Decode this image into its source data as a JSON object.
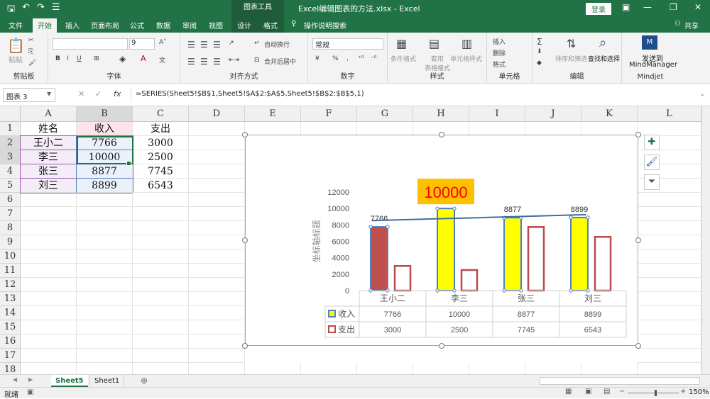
{
  "titlebar": {
    "chart_tools": "图表工具",
    "title": "Excel编辑图表的方法.xlsx  -  Excel",
    "login": "登录"
  },
  "tabs": [
    "文件",
    "开始",
    "插入",
    "页面布局",
    "公式",
    "数据",
    "审阅",
    "视图",
    "设计",
    "格式",
    "操作说明搜索"
  ],
  "share": "共享",
  "ribbon": {
    "paste": "粘贴",
    "clipboard": "剪贴板",
    "font_size": "9",
    "font_group": "字体",
    "wrap": "自动换行",
    "merge": "合并后居中",
    "align_group": "对齐方式",
    "number_format": "常规",
    "number_group": "数字",
    "cond_format": "条件格式",
    "table_format": "套用\n表格格式",
    "cell_style": "单元格样式",
    "style_group": "样式",
    "insert": "插入",
    "delete": "删除",
    "format": "格式",
    "cells_group": "单元格",
    "sort_filter": "排序和筛选",
    "find_select": "查找和选择",
    "edit_group": "编辑",
    "send_to": "发送到",
    "mindmanager": "MindManager",
    "mindjet": "Mindjet"
  },
  "formula": {
    "name_box": "图表 3",
    "formula_text": "=SERIES(Sheet5!$B$1,Sheet5!$A$2:$A$5,Sheet5!$B$2:$B$5,1)"
  },
  "columns": [
    "A",
    "B",
    "C",
    "D",
    "E",
    "F",
    "G",
    "H",
    "I",
    "J",
    "K",
    "L"
  ],
  "rows": [
    "1",
    "2",
    "3",
    "4",
    "5",
    "6",
    "7",
    "8",
    "9",
    "10",
    "11",
    "12",
    "13",
    "14",
    "15",
    "16",
    "17",
    "18"
  ],
  "cells": [
    [
      "姓名",
      "收入",
      "支出"
    ],
    [
      "王小二",
      "7766",
      "3000"
    ],
    [
      "李三",
      "10000",
      "2500"
    ],
    [
      "张三",
      "8877",
      "7745"
    ],
    [
      "刘三",
      "8899",
      "6543"
    ]
  ],
  "chart_data": {
    "type": "bar",
    "categories": [
      "王小二",
      "李三",
      "张三",
      "刘三"
    ],
    "series": [
      {
        "name": "收入",
        "values": [
          7766,
          10000,
          8877,
          8899
        ],
        "color": "#ffff00"
      },
      {
        "name": "支出",
        "values": [
          3000,
          2500,
          7745,
          6543
        ],
        "color": "#ffffff"
      }
    ],
    "ylabel": "坐标轴标题",
    "yticks": [
      0,
      2000,
      4000,
      6000,
      8000,
      10000,
      12000
    ],
    "ylim": [
      0,
      12000
    ],
    "highlight_label": "10000",
    "trendline": true,
    "data_table": true,
    "colors": {
      "accent": "#217346",
      "bar_first": "#c0504d",
      "outline": "#4f81bd",
      "expense_outline": "#b94a48",
      "label_bg": "#ffc000",
      "label_text": "#ff0000"
    }
  },
  "sheets": [
    "Sheet5",
    "Sheet1"
  ],
  "status": {
    "ready": "就绪",
    "zoom": "150%"
  }
}
